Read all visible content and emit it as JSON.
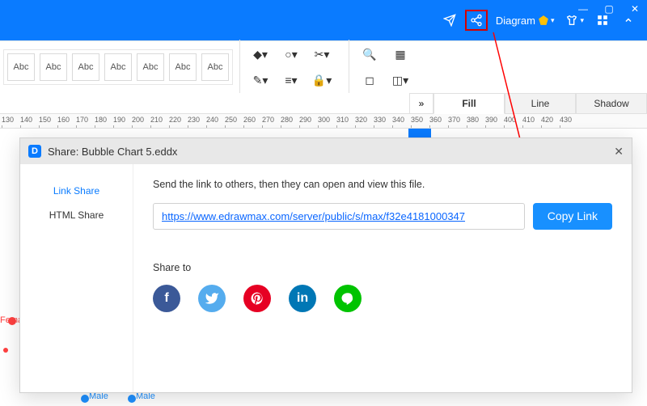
{
  "titlebar": {
    "diagram_label": "Diagram"
  },
  "ribbon": {
    "style_label": "Abc",
    "style_count": 7
  },
  "tabs": {
    "fill": "Fill",
    "line": "Line",
    "shadow": "Shadow"
  },
  "ruler": {
    "ticks": [
      130,
      140,
      150,
      160,
      170,
      180,
      190,
      200,
      210,
      220,
      230,
      240,
      250,
      260,
      270,
      280,
      290,
      300,
      310,
      320,
      330,
      340,
      350,
      360,
      370,
      380,
      390,
      400,
      410,
      420,
      430
    ]
  },
  "chart": {
    "labels": {
      "female": "Female",
      "female_short": "Fema",
      "male": "Male"
    }
  },
  "share": {
    "title": "Share: Bubble Chart 5.eddx",
    "sidebar": {
      "link": "Link Share",
      "html": "HTML Share"
    },
    "instruction": "Send the link to others, then they can open and view this file.",
    "url": "https://www.edrawmax.com/server/public/s/max/f32e4181000347",
    "copy": "Copy Link",
    "share_to": "Share to"
  }
}
